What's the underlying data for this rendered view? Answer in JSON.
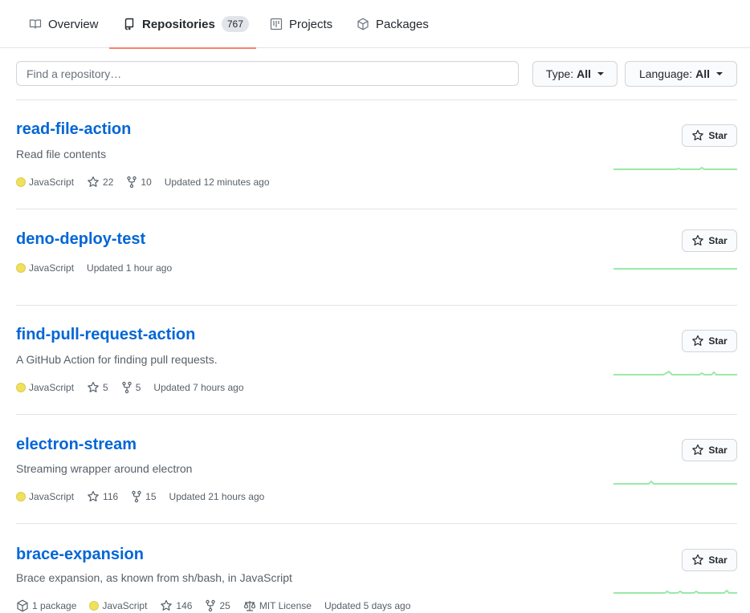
{
  "tabs": [
    {
      "label": "Overview",
      "icon": "book-icon"
    },
    {
      "label": "Repositories",
      "icon": "repo-icon",
      "counter": "767",
      "selected": true
    },
    {
      "label": "Projects",
      "icon": "project-icon"
    },
    {
      "label": "Packages",
      "icon": "package-icon"
    }
  ],
  "filter": {
    "search_placeholder": "Find a repository…",
    "type_label": "Type:",
    "type_value": "All",
    "language_label": "Language:",
    "language_value": "All"
  },
  "star_label": "Star",
  "colors": {
    "accent": "#f9826c",
    "link": "#0366d6",
    "javascript": "#f1e05a",
    "sparkline": "#2cbe4e"
  },
  "repos": [
    {
      "name": "read-file-action",
      "description": "Read file contents",
      "language": "JavaScript",
      "stars": "22",
      "forks": "10",
      "updated": "Updated 12 minutes ago"
    },
    {
      "name": "deno-deploy-test",
      "description": "",
      "language": "JavaScript",
      "updated": "Updated 1 hour ago"
    },
    {
      "name": "find-pull-request-action",
      "description": "A GitHub Action for finding pull requests.",
      "language": "JavaScript",
      "stars": "5",
      "forks": "5",
      "updated": "Updated 7 hours ago"
    },
    {
      "name": "electron-stream",
      "description": "Streaming wrapper around electron",
      "language": "JavaScript",
      "stars": "116",
      "forks": "15",
      "updated": "Updated 21 hours ago"
    },
    {
      "name": "brace-expansion",
      "description": "Brace expansion, as known from sh/bash, in JavaScript",
      "packages": "1 package",
      "language": "JavaScript",
      "stars": "146",
      "forks": "25",
      "license": "MIT License",
      "updated": "Updated 5 days ago"
    }
  ]
}
